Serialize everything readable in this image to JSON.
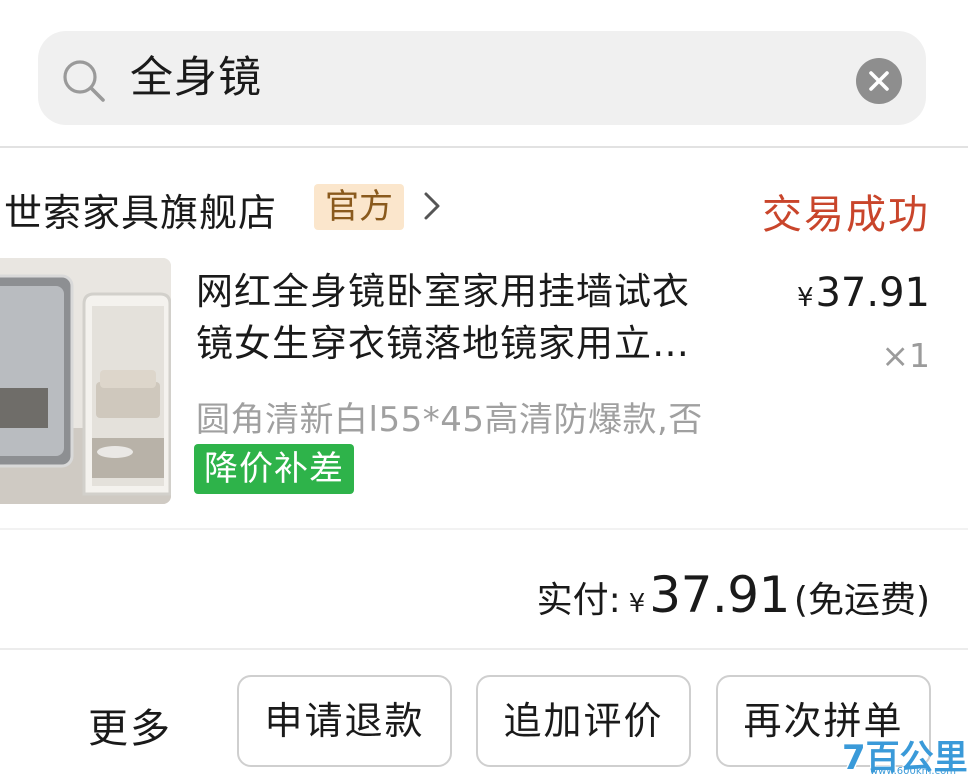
{
  "search": {
    "query": "全身镜"
  },
  "order": {
    "store_name": "世索家具旗舰店",
    "official_badge": "官方",
    "status": "交易成功",
    "product": {
      "title_line1": "网红全身镜卧室家用挂墙试衣",
      "title_line2": "镜女生穿衣镜落地镜家用立…",
      "currency": "¥",
      "price": "37.91",
      "quantity": "×1",
      "sku": "圆角清新白l55*45高清防爆款,否",
      "tag": "降价补差"
    },
    "payment": {
      "label": "实付:",
      "currency": "¥",
      "amount": "37.91",
      "note": "(免运费)"
    }
  },
  "actions": {
    "more": "更多",
    "refund": "申请退款",
    "review": "追加评价",
    "reorder": "再次拼单"
  },
  "watermark": {
    "logo": "7百公里",
    "url": "www.600km.com"
  },
  "colors": {
    "status": "#c9452b",
    "tag_bg": "#2eb34a",
    "badge_bg": "#fbe6cc",
    "badge_text": "#8a5a1d",
    "watermark": "#3a9ad9"
  }
}
